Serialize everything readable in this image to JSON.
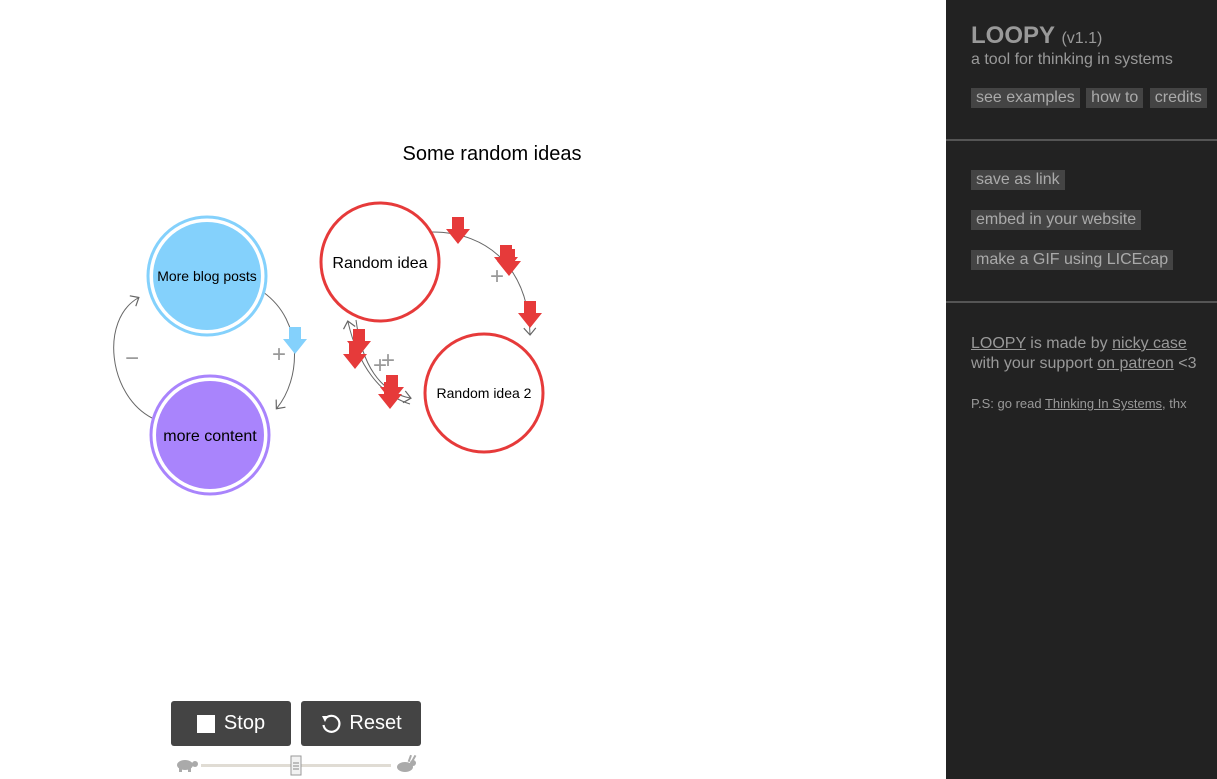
{
  "canvas": {
    "title": "Some random ideas",
    "nodes": [
      {
        "label": "More blog posts",
        "color": "#84d1fc"
      },
      {
        "label": "more content",
        "color": "#a984fc"
      },
      {
        "label": "Random idea",
        "color": "#ffffff",
        "stroke": "#e63a3a"
      },
      {
        "label": "Random idea 2",
        "color": "#ffffff",
        "stroke": "#e63a3a"
      }
    ],
    "signs": {
      "plus": "+",
      "minus": "−"
    },
    "colors": {
      "blue": "#84d1fc",
      "purple": "#a984fc",
      "red": "#e63a3a"
    }
  },
  "controls": {
    "stop_label": "Stop",
    "reset_label": "Reset",
    "speed_slider": {
      "value_fraction": 0.5
    }
  },
  "sidebar": {
    "title": "LOOPY",
    "version": "(v1.1)",
    "subtitle": "a tool for thinking in systems",
    "top_buttons": [
      "see examples",
      "how to",
      "credits"
    ],
    "share_buttons": [
      "save as link",
      "embed in your website",
      "make a GIF using LICEcap"
    ],
    "credits": {
      "loopy_link": "LOOPY",
      "made_by": " is made by ",
      "author_link": "nicky case",
      "with_support": "with your support ",
      "patreon_link": "on patreon",
      "heart": " <3"
    },
    "ps": {
      "prefix": "P.S: go read ",
      "book_link": "Thinking In Systems",
      "suffix": ", thx"
    }
  }
}
